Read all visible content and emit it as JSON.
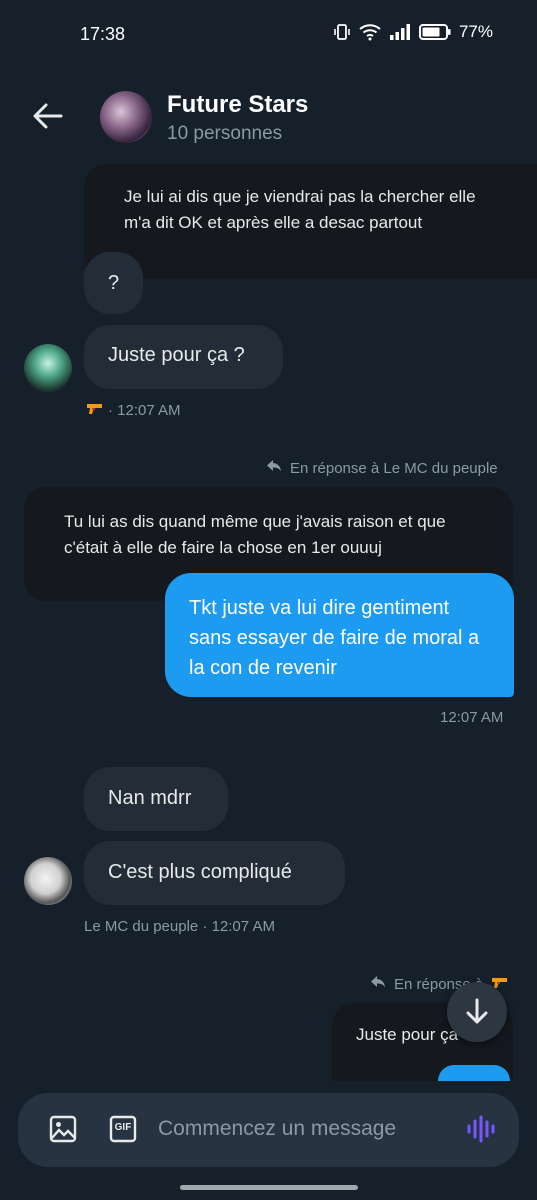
{
  "status": {
    "time": "17:38",
    "battery": "77%"
  },
  "header": {
    "title": "Future Stars",
    "subtitle": "10 personnes"
  },
  "messages": {
    "m1": "Je lui ai dis que je viendrai pas la chercher elle m'a dit OK et après elle a desac partout",
    "m2": "?",
    "m3": "Juste pour ça ?",
    "m3_meta": "· 12:07 AM",
    "reply1": "En réponse à Le MC du peuple",
    "quote1": "Tu lui as dis quand même que j'avais raison et que c'était à elle de faire la chose en 1er ouuuj",
    "m4": "Tkt juste va lui dire gentiment sans essayer de faire de moral a la con de revenir",
    "m4_meta": "12:07 AM",
    "m5": "Nan mdrr",
    "m6": "C'est plus compliqué",
    "m6_meta": "Le MC du peuple · 12:07 AM",
    "reply2": "En réponse à",
    "quote2": "Juste pour ça"
  },
  "composer": {
    "placeholder": "Commencez un message",
    "gif_label": "GIF"
  },
  "colors": {
    "background": "#15202b",
    "bubble_in": "#222d37",
    "bubble_out": "#1d9bf0",
    "quote": "#15191d",
    "accent_voice": "#7856ff"
  },
  "icons": [
    "arrow-left-icon",
    "image-icon",
    "gif-icon",
    "voice-icon",
    "arrow-down-icon",
    "reply-icon",
    "gun-emoji-icon"
  ]
}
